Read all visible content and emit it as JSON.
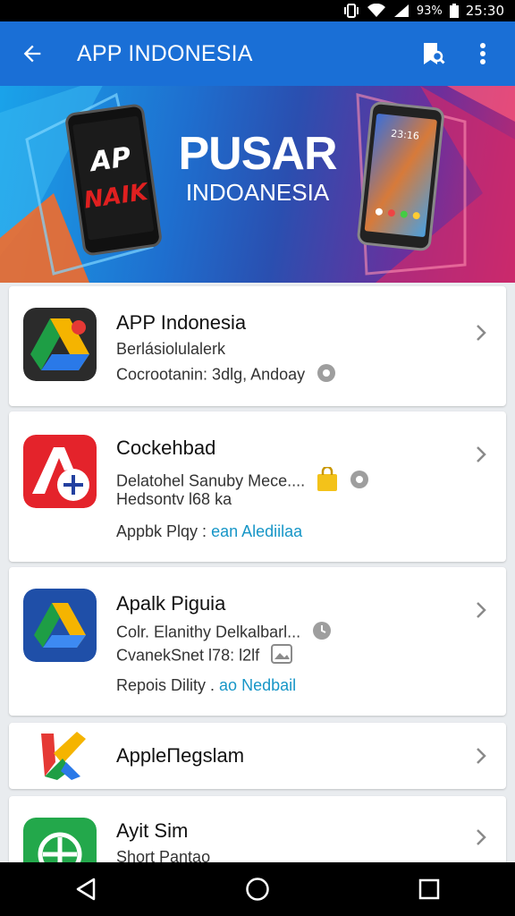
{
  "status": {
    "time": "25:30",
    "battery": "93%"
  },
  "appbar": {
    "title": "APP INDONESIA"
  },
  "banner": {
    "headline": "PUSAR",
    "subheadline": "INDOANESIA",
    "phone_logo_top": "AP",
    "phone_logo_bottom": "NAIK",
    "phone_clock": "23:16"
  },
  "apps": [
    {
      "name": "APP Indonesia",
      "line1": "Berlásiolulalerk",
      "line2": "Cocrootanin: 3dlg, Andoay"
    },
    {
      "name": "Cockehbad",
      "line1": "Delatohel Sanuby Mece....",
      "line2": "Hedsontv l68 ka",
      "line3_prefix": "Appbk Plqy :",
      "line3_link": "ean Alediilaa"
    },
    {
      "name": "Apalk Piguia",
      "line1": "Colr. Elanithy Delkalbarl...",
      "line2": "CvanekSnet l78: l2lf",
      "line3_prefix": "Repois Dility .",
      "line3_link": "ao Nedbail"
    },
    {
      "name": "AppleΠegslam"
    },
    {
      "name": "Ayit Sim",
      "line1": "Short Pantao"
    }
  ],
  "colors": {
    "appbar": "#1a6fd6",
    "link": "#1796c7",
    "statusbar": "#000000"
  }
}
